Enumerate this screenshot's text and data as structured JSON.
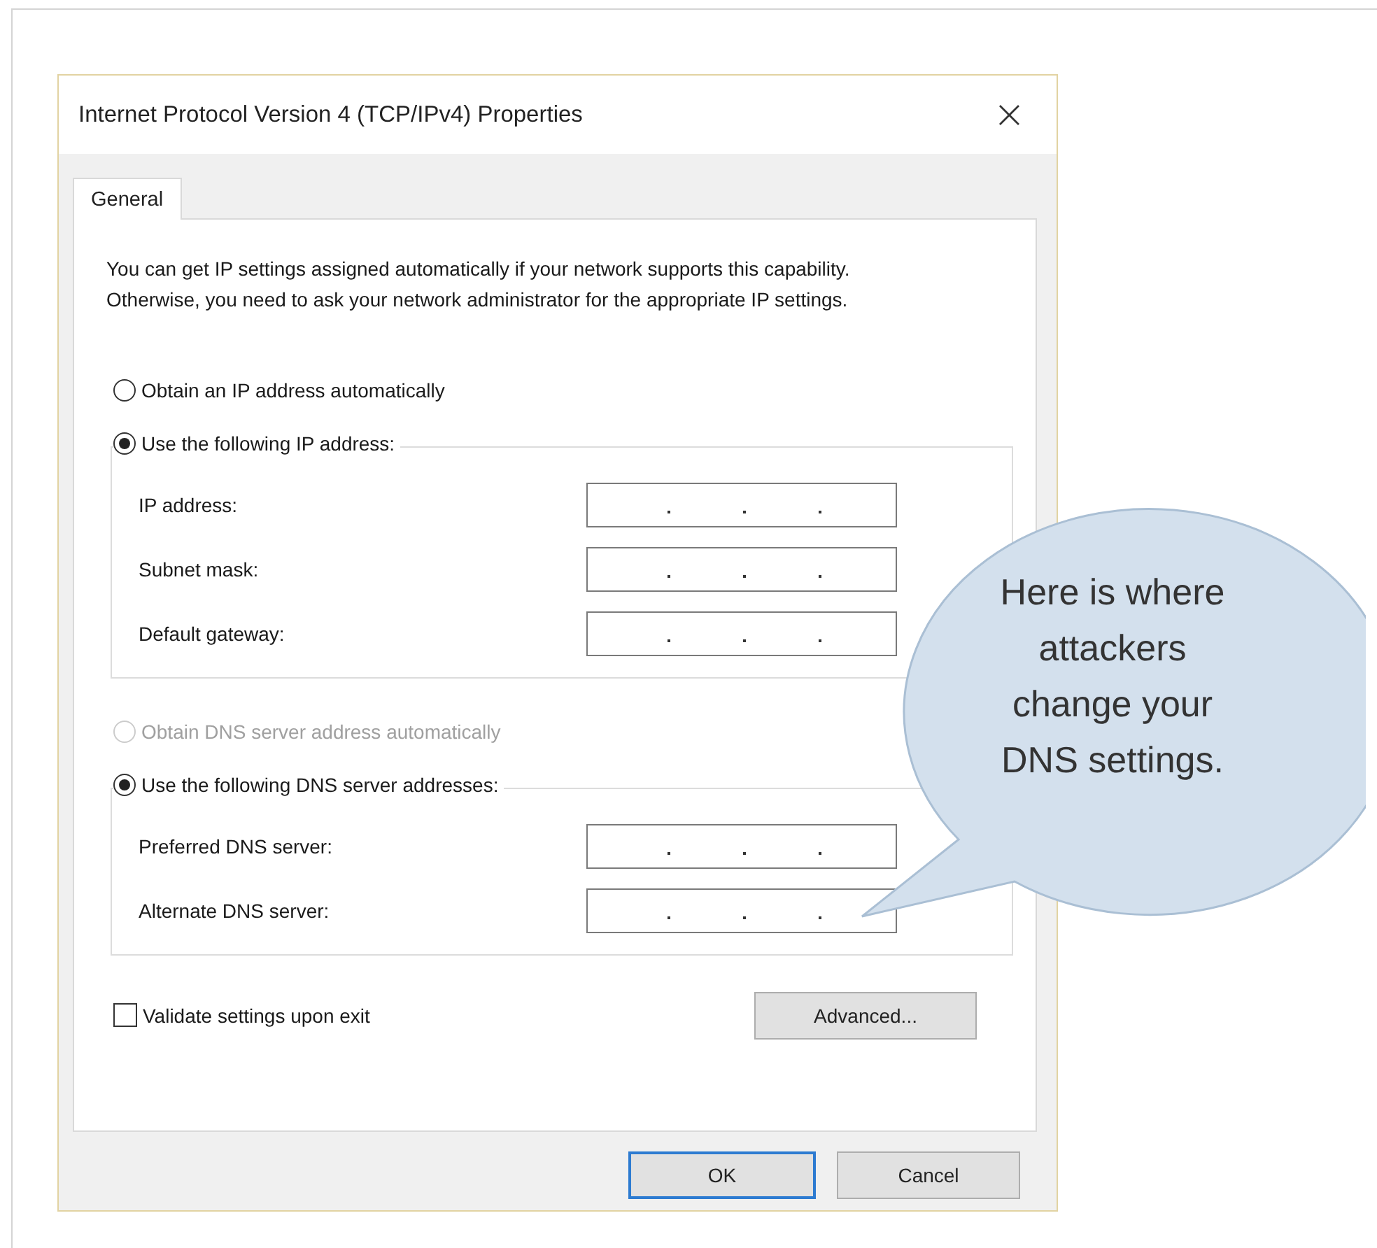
{
  "window": {
    "title": "Internet Protocol Version 4 (TCP/IPv4) Properties",
    "close": "×"
  },
  "tabs": [
    {
      "label": "General",
      "selected": true
    }
  ],
  "description": "You can get IP settings assigned automatically if your network supports this capability. Otherwise, you need to ask your network administrator for the appropriate IP settings.",
  "sections": [
    {
      "auto": {
        "label": "Obtain an IP address automatically",
        "selected": false,
        "disabled": false
      },
      "manual": {
        "label": "Use the following IP address:",
        "selected": true,
        "disabled": false
      },
      "fields": [
        {
          "label": "IP address:"
        },
        {
          "label": "Subnet mask:"
        },
        {
          "label": "Default gateway:"
        }
      ]
    },
    {
      "auto": {
        "label": "Obtain DNS server address automatically",
        "selected": false,
        "disabled": true
      },
      "manual": {
        "label": "Use the following DNS server addresses:",
        "selected": true,
        "disabled": false
      },
      "fields": [
        {
          "label": "Preferred DNS server:"
        },
        {
          "label": "Alternate DNS server:"
        }
      ]
    }
  ],
  "validate": {
    "label": "Validate settings upon exit",
    "checked": false
  },
  "advanced_button": "Advanced...",
  "buttons": [
    {
      "label": "OK",
      "default": true
    },
    {
      "label": "Cancel",
      "default": false
    }
  ],
  "callout": {
    "lines": [
      "Here is where",
      "attackers",
      "change your",
      "DNS settings."
    ]
  }
}
